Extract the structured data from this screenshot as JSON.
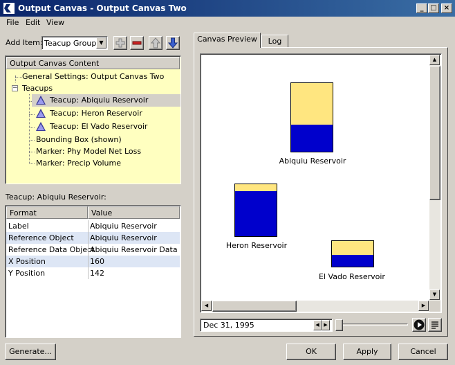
{
  "window": {
    "title": "Output Canvas - Output Canvas Two",
    "controls": [
      "_",
      "□",
      "×"
    ]
  },
  "menu": [
    "File",
    "Edit",
    "View"
  ],
  "add_item": {
    "label": "Add Item:",
    "selected": "Teacup Group"
  },
  "tree": {
    "header": "Output Canvas Content",
    "items": [
      "General Settings: Output Canvas Two",
      "Teacups",
      "Teacup: Abiquiu Reservoir",
      "Teacup: Heron Reservoir",
      "Teacup: El Vado Reservoir",
      "Bounding Box (shown)",
      "Marker: Phy Model Net Loss",
      "Marker: Precip Volume"
    ],
    "expander": "−"
  },
  "props": {
    "title": "Teacup: Abiquiu Reservoir:",
    "columns": [
      "Format",
      "Value"
    ],
    "rows": [
      {
        "k": "Label",
        "v": "Abiquiu Reservoir"
      },
      {
        "k": "Reference Object",
        "v": "Abiquiu Reservoir"
      },
      {
        "k": "Reference Data Object",
        "v": "Abiquiu Reservoir Data"
      },
      {
        "k": "X Position",
        "v": "160"
      },
      {
        "k": "Y Position",
        "v": "142"
      }
    ]
  },
  "tabs": [
    "Canvas Preview",
    "Log"
  ],
  "canvas": {
    "teacups": [
      {
        "label": "Abiquiu Reservoir",
        "fill_fraction": 0.39
      },
      {
        "label": "Heron Reservoir",
        "fill_fraction": 0.87
      },
      {
        "label": "El Vado Reservoir",
        "fill_fraction": 0.47
      }
    ],
    "water_color": "#0000cc",
    "cup_color": "#ffe680"
  },
  "date": "Dec 31, 1995",
  "buttons": {
    "generate": "Generate...",
    "ok": "OK",
    "apply": "Apply",
    "cancel": "Cancel"
  }
}
